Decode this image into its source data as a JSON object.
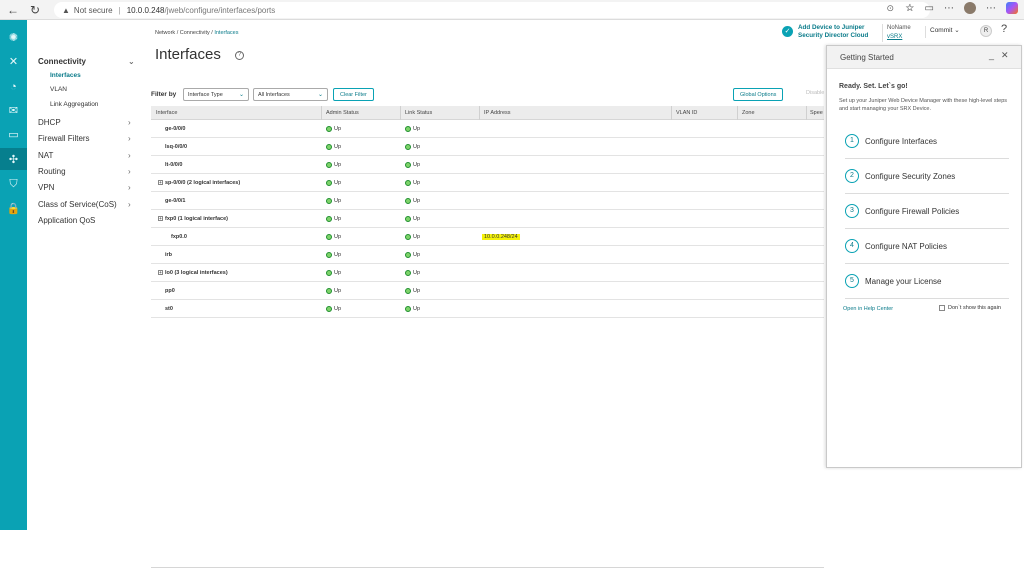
{
  "browser": {
    "back": "←",
    "refresh": "↻",
    "warning": "▲",
    "security_label": "Not secure",
    "url_host": "10.0.0.248",
    "url_path": "/jweb/configure/interfaces/ports"
  },
  "sidenav": {
    "section": "Connectivity",
    "subitems": [
      "Interfaces",
      "VLAN",
      "Link Aggregation"
    ],
    "items": [
      "DHCP",
      "Firewall Filters",
      "NAT",
      "Routing",
      "VPN",
      "Class of Service(CoS)",
      "Application QoS"
    ]
  },
  "header": {
    "breadcrumb": [
      "Network",
      "Connectivity",
      "Interfaces"
    ],
    "title": "Interfaces",
    "sdc_line1": "Add Device to Juniper",
    "sdc_line2": "Security Director Cloud",
    "device_name": "NoName",
    "device_model": "vSRX",
    "commit": "Commit",
    "user_initial": "R",
    "help": "?"
  },
  "filter": {
    "label": "Filter by",
    "type_value": "Interface Type",
    "interfaces_value": "All Interfaces",
    "clear_button": "Clear Filter",
    "global_options": "Global Options",
    "disable": "Disable"
  },
  "table": {
    "columns": [
      "Interface",
      "Admin Status",
      "Link Status",
      "IP Address",
      "VLAN ID",
      "Zone",
      "Spee"
    ],
    "rows": [
      {
        "name": "ge-0/0/0",
        "admin": "Up",
        "link": "Up",
        "ip": "",
        "expand": false,
        "indent": false,
        "hl": false
      },
      {
        "name": "lsq-0/0/0",
        "admin": "Up",
        "link": "Up",
        "ip": "",
        "expand": false,
        "indent": false,
        "hl": false
      },
      {
        "name": "lt-0/0/0",
        "admin": "Up",
        "link": "Up",
        "ip": "",
        "expand": false,
        "indent": false,
        "hl": false
      },
      {
        "name": "sp-0/0/0 (2 logical interfaces)",
        "admin": "Up",
        "link": "Up",
        "ip": "",
        "expand": true,
        "indent": false,
        "hl": false
      },
      {
        "name": "ge-0/0/1",
        "admin": "Up",
        "link": "Up",
        "ip": "",
        "expand": false,
        "indent": false,
        "hl": false
      },
      {
        "name": "fxp0 (1 logical interface)",
        "admin": "Up",
        "link": "Up",
        "ip": "",
        "expand": true,
        "indent": false,
        "hl": false
      },
      {
        "name": "fxp0.0",
        "admin": "Up",
        "link": "Up",
        "ip": "10.0.0.248/24",
        "expand": false,
        "indent": true,
        "hl": true
      },
      {
        "name": "irb",
        "admin": "Up",
        "link": "Up",
        "ip": "",
        "expand": false,
        "indent": false,
        "hl": false
      },
      {
        "name": "lo0 (3 logical interfaces)",
        "admin": "Up",
        "link": "Up",
        "ip": "",
        "expand": true,
        "indent": false,
        "hl": false
      },
      {
        "name": "pp0",
        "admin": "Up",
        "link": "Up",
        "ip": "",
        "expand": false,
        "indent": false,
        "hl": false
      },
      {
        "name": "st0",
        "admin": "Up",
        "link": "Up",
        "ip": "",
        "expand": false,
        "indent": false,
        "hl": false
      }
    ]
  },
  "getting_started": {
    "title": "Getting Started",
    "lead": "Ready. Set. Let`s go!",
    "desc": "Set up your Juniper Web Device Manager with these high-level steps and start managing your SRX Device.",
    "steps": [
      {
        "num": "1",
        "label": "Configure Interfaces"
      },
      {
        "num": "2",
        "label": "Configure Security Zones"
      },
      {
        "num": "3",
        "label": "Configure Firewall Policies"
      },
      {
        "num": "4",
        "label": "Configure NAT Policies"
      },
      {
        "num": "5",
        "label": "Manage your License"
      }
    ],
    "help_link": "Open in Help Center",
    "dont_show": "Don`t show this again"
  }
}
